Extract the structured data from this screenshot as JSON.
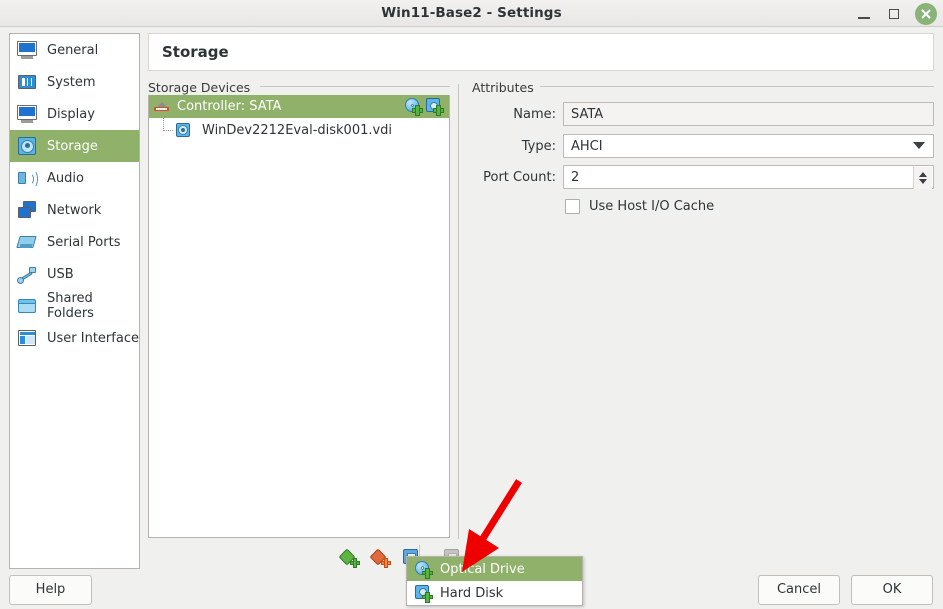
{
  "window": {
    "title": "Win11-Base2 - Settings",
    "minimize_label": "Minimize",
    "maximize_label": "Maximize",
    "close_label": "Close"
  },
  "sidebar": {
    "items": [
      {
        "label": "General",
        "icon": "monitor-icon",
        "selected": false
      },
      {
        "label": "System",
        "icon": "motherboard-icon",
        "selected": false
      },
      {
        "label": "Display",
        "icon": "display-icon",
        "selected": false
      },
      {
        "label": "Storage",
        "icon": "harddisk-icon",
        "selected": true
      },
      {
        "label": "Audio",
        "icon": "speaker-icon",
        "selected": false
      },
      {
        "label": "Network",
        "icon": "network-icon",
        "selected": false
      },
      {
        "label": "Serial Ports",
        "icon": "serial-port-icon",
        "selected": false
      },
      {
        "label": "USB",
        "icon": "usb-icon",
        "selected": false
      },
      {
        "label": "Shared Folders",
        "icon": "folder-icon",
        "selected": false
      },
      {
        "label": "User Interface",
        "icon": "layout-icon",
        "selected": false
      }
    ]
  },
  "header": {
    "title": "Storage"
  },
  "storage_devices": {
    "group_label": "Storage Devices",
    "controller": {
      "label": "Controller: SATA",
      "icon": "sata-controller-icon",
      "actions": [
        {
          "name": "add-optical-drive-icon",
          "label": "Add Optical Drive"
        },
        {
          "name": "add-hard-disk-icon",
          "label": "Add Hard Disk"
        }
      ]
    },
    "attachments": [
      {
        "label": "WinDev2212Eval-disk001.vdi",
        "icon": "harddisk-icon"
      }
    ],
    "toolbar": [
      {
        "name": "add-controller-button",
        "label": "Add Controller",
        "enabled": true
      },
      {
        "name": "remove-controller-button",
        "label": "Remove Controller",
        "enabled": true
      },
      {
        "name": "add-attachment-button",
        "label": "Add Attachment",
        "enabled": true
      },
      {
        "name": "remove-attachment-button",
        "label": "Remove Attachment",
        "enabled": false
      }
    ]
  },
  "attributes": {
    "group_label": "Attributes",
    "name": {
      "label": "Name:",
      "value": "SATA"
    },
    "type": {
      "label": "Type:",
      "value": "AHCI"
    },
    "port_count": {
      "label": "Port Count:",
      "value": "2"
    },
    "use_host_io_cache": {
      "label": "Use Host I/O Cache",
      "checked": false
    }
  },
  "popup_menu": {
    "items": [
      {
        "label": "Optical Drive",
        "icon": "optical-drive-icon",
        "highlighted": true
      },
      {
        "label": "Hard Disk",
        "icon": "hard-disk-icon",
        "highlighted": false
      }
    ]
  },
  "footer": {
    "help": "Help",
    "cancel": "Cancel",
    "ok": "OK"
  },
  "annotation": {
    "arrow_color": "#ef0000",
    "points_to": "Optical Drive"
  }
}
